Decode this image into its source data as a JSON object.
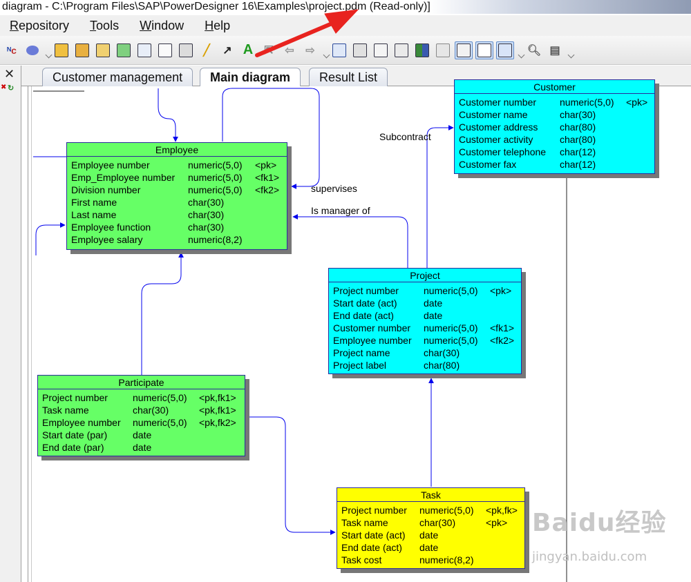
{
  "window": {
    "title": "diagram - C:\\Program Files\\SAP\\PowerDesigner 16\\Examples\\project.pdm (Read-only)]"
  },
  "menu": {
    "items": [
      {
        "underline": "R",
        "rest": "epository"
      },
      {
        "underline": "T",
        "rest": "ools"
      },
      {
        "underline": "W",
        "rest": "indow"
      },
      {
        "underline": "H",
        "rest": "elp"
      }
    ]
  },
  "tabs": [
    "Customer management",
    "Main diagram",
    "Result List"
  ],
  "selected_tab": "Main diagram",
  "entities": {
    "employee": {
      "name": "Employee",
      "rows": [
        [
          "Employee number",
          "numeric(5,0)",
          "<pk>"
        ],
        [
          "Emp_Employee number",
          "numeric(5,0)",
          "<fk1>"
        ],
        [
          "Division number",
          "numeric(5,0)",
          "<fk2>"
        ],
        [
          "First name",
          "char(30)",
          ""
        ],
        [
          "Last name",
          "char(30)",
          ""
        ],
        [
          "Employee function",
          "char(30)",
          ""
        ],
        [
          "Employee salary",
          "numeric(8,2)",
          ""
        ]
      ]
    },
    "customer": {
      "name": "Customer",
      "rows": [
        [
          "Customer number",
          "numeric(5,0)",
          "<pk>"
        ],
        [
          "Customer name",
          "char(30)",
          ""
        ],
        [
          "Customer address",
          "char(80)",
          ""
        ],
        [
          "Customer activity",
          "char(80)",
          ""
        ],
        [
          "Customer telephone",
          "char(12)",
          ""
        ],
        [
          "Customer fax",
          "char(12)",
          ""
        ]
      ]
    },
    "project": {
      "name": "Project",
      "rows": [
        [
          "Project number",
          "numeric(5,0)",
          "<pk>"
        ],
        [
          "Start date (act)",
          "date",
          ""
        ],
        [
          "End date (act)",
          "date",
          ""
        ],
        [
          "Customer number",
          "numeric(5,0)",
          "<fk1>"
        ],
        [
          "Employee number",
          "numeric(5,0)",
          "<fk2>"
        ],
        [
          "Project name",
          "char(30)",
          ""
        ],
        [
          "Project label",
          "char(80)",
          ""
        ]
      ]
    },
    "participate": {
      "name": "Participate",
      "rows": [
        [
          "Project number",
          "numeric(5,0)",
          "<pk,fk1>"
        ],
        [
          "Task name",
          "char(30)",
          "<pk,fk1>"
        ],
        [
          "Employee number",
          "numeric(5,0)",
          "<pk,fk2>"
        ],
        [
          "Start date (par)",
          "date",
          ""
        ],
        [
          "End date (par)",
          "date",
          ""
        ]
      ]
    },
    "task": {
      "name": "Task",
      "rows": [
        [
          "Project number",
          "numeric(5,0)",
          "<pk,fk>"
        ],
        [
          "Task name",
          "char(30)",
          "<pk>"
        ],
        [
          "Start date (act)",
          "date",
          ""
        ],
        [
          "End date (act)",
          "date",
          ""
        ],
        [
          "Task cost",
          "numeric(8,2)",
          ""
        ]
      ]
    }
  },
  "relationship_labels": {
    "subcontract": "Subcontract",
    "supervises": "supervises",
    "is_manager_of": "Is manager of"
  },
  "watermark": {
    "main": "Baidu经验",
    "sub": "jingyan.baidu.com"
  },
  "colors": {
    "employee": "#66ff66",
    "customer": "#00ffff",
    "project": "#00ffff",
    "participate": "#66ff66",
    "task": "#ffff00",
    "link": "#0000ee",
    "annotation_arrow": "#e8231f"
  }
}
